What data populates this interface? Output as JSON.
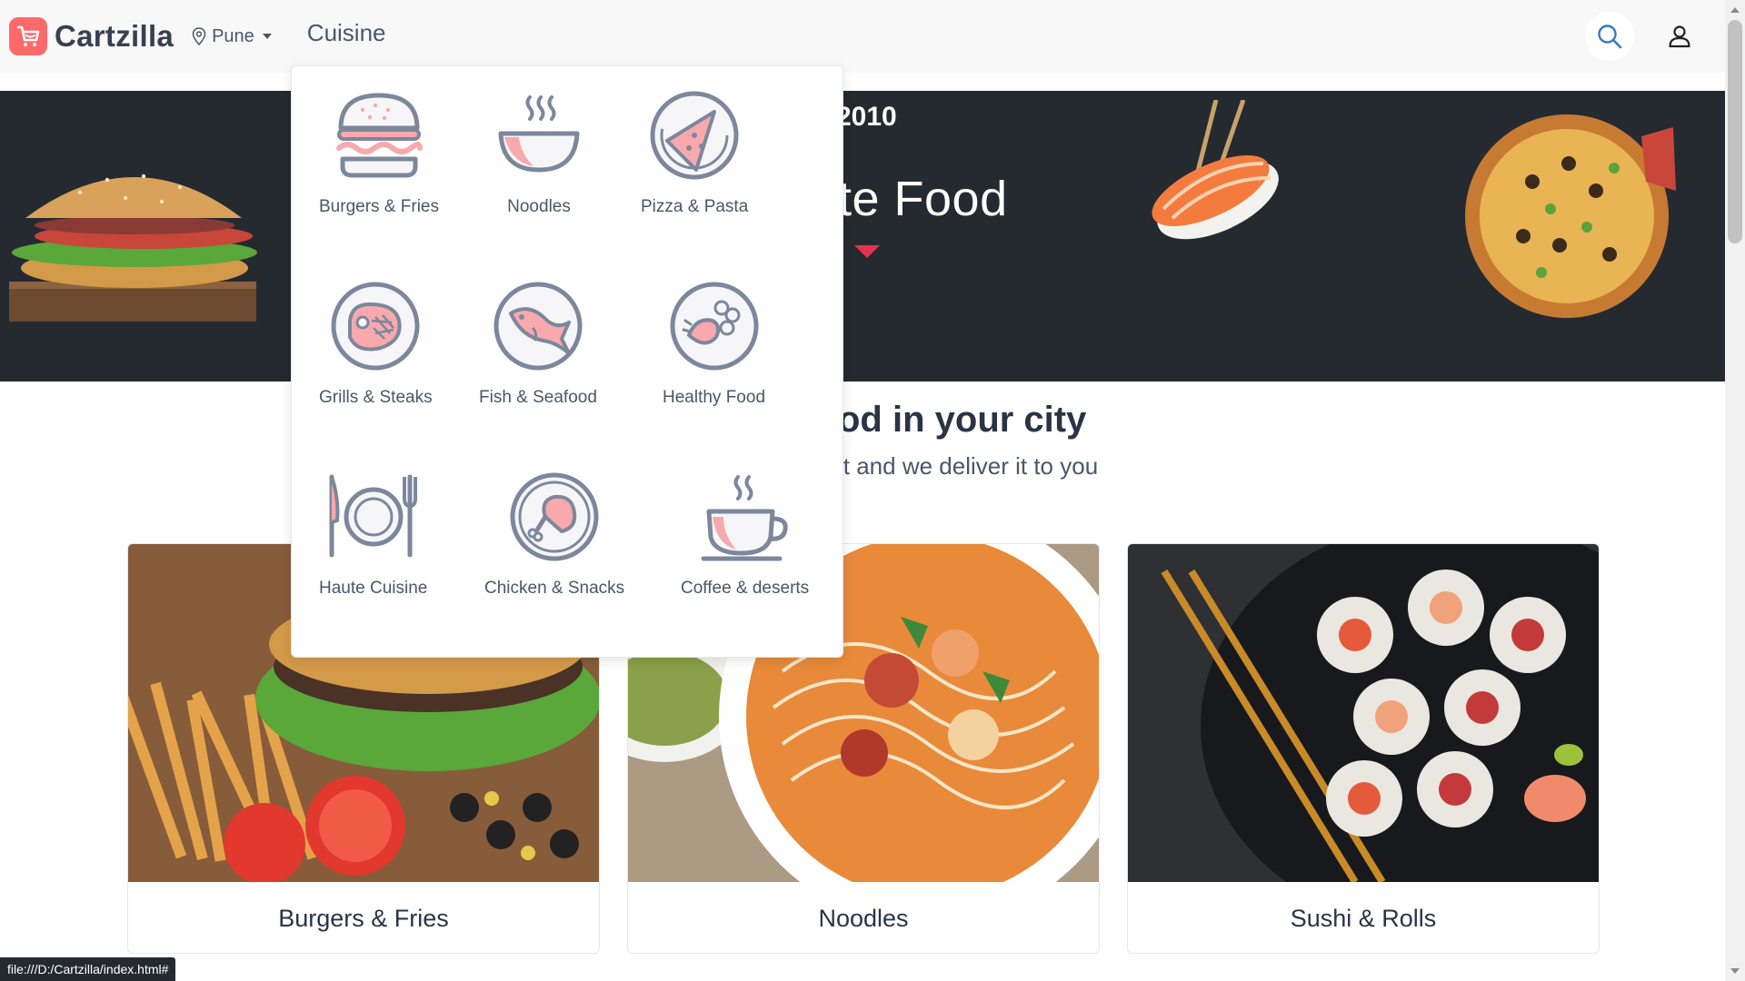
{
  "navbar": {
    "brand_name": "Cartzilla",
    "location": "Pune",
    "cuisine_label": "Cuisine"
  },
  "hero": {
    "year": "2010",
    "title_fragment": "te Food"
  },
  "section": {
    "title_fragment": "od in your city",
    "subtitle_fragment": "it and we deliver it to you"
  },
  "dropdown": {
    "items": [
      {
        "label": "Burgers & Fries",
        "icon": "burger-icon"
      },
      {
        "label": "Noodles",
        "icon": "noodles-bowl-icon"
      },
      {
        "label": "Pizza & Pasta",
        "icon": "pizza-icon"
      },
      {
        "label": "Grills & Steaks",
        "icon": "steak-icon"
      },
      {
        "label": "Fish & Seafood",
        "icon": "fish-icon"
      },
      {
        "label": "Healthy Food",
        "icon": "healthy-food-icon"
      },
      {
        "label": "Haute Cuisine",
        "icon": "plate-cutlery-icon"
      },
      {
        "label": "Chicken & Snacks",
        "icon": "chicken-leg-icon"
      },
      {
        "label": "Coffee & deserts",
        "icon": "coffee-cup-icon"
      }
    ]
  },
  "cards": [
    {
      "title": "Burgers & Fries"
    },
    {
      "title": "Noodles"
    },
    {
      "title": "Sushi & Rolls"
    }
  ],
  "statusbar": {
    "url": "file:///D:/Cartzilla/index.html#"
  },
  "colors": {
    "accent": "#fe696a",
    "icon_stroke": "#7d879c",
    "icon_fill": "#f8a9ad",
    "hero_bg": "#252a31"
  }
}
